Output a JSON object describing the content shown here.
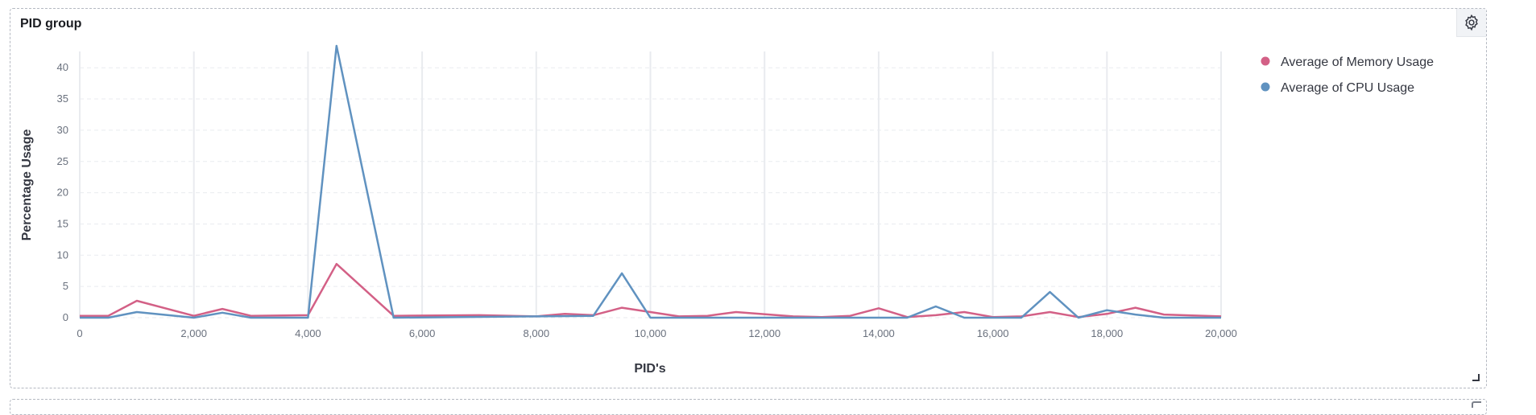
{
  "panel": {
    "title": "PID group"
  },
  "colors": {
    "memory": "#d36086",
    "cpu": "#6092c0",
    "grid": "#e9ebef"
  },
  "chart_data": {
    "type": "line",
    "xlabel": "PID's",
    "ylabel": "Percentage Usage",
    "xlim": [
      0,
      20000
    ],
    "ylim": [
      0,
      45
    ],
    "x_ticks": [
      0,
      2000,
      4000,
      6000,
      8000,
      10000,
      12000,
      14000,
      16000,
      18000,
      20000
    ],
    "x_tick_labels": [
      "0",
      "2,000",
      "4,000",
      "6,000",
      "8,000",
      "10,000",
      "12,000",
      "14,000",
      "16,000",
      "18,000",
      "20,000"
    ],
    "y_ticks": [
      0,
      5,
      10,
      15,
      20,
      25,
      30,
      35,
      40
    ],
    "y_tick_labels": [
      "0",
      "5",
      "10",
      "15",
      "20",
      "25",
      "30",
      "35",
      "40"
    ],
    "grid": true,
    "legend_position": "right",
    "series": [
      {
        "name": "Average of Memory Usage",
        "color": "#d36086",
        "points": [
          [
            0,
            0.3
          ],
          [
            500,
            0.3
          ],
          [
            1000,
            2.7
          ],
          [
            2000,
            0.3
          ],
          [
            2500,
            1.4
          ],
          [
            3000,
            0.3
          ],
          [
            4000,
            0.4
          ],
          [
            4500,
            8.6
          ],
          [
            5500,
            0.3
          ],
          [
            7000,
            0.4
          ],
          [
            8000,
            0.2
          ],
          [
            8500,
            0.6
          ],
          [
            9000,
            0.4
          ],
          [
            9500,
            1.6
          ],
          [
            10500,
            0.2
          ],
          [
            11000,
            0.3
          ],
          [
            11500,
            0.9
          ],
          [
            12500,
            0.2
          ],
          [
            13000,
            0.1
          ],
          [
            13500,
            0.3
          ],
          [
            14000,
            1.5
          ],
          [
            14500,
            0.1
          ],
          [
            15000,
            0.4
          ],
          [
            15500,
            0.9
          ],
          [
            16000,
            0.1
          ],
          [
            16500,
            0.2
          ],
          [
            17000,
            0.9
          ],
          [
            17500,
            0.1
          ],
          [
            18000,
            0.6
          ],
          [
            18500,
            1.6
          ],
          [
            19000,
            0.5
          ],
          [
            20000,
            0.2
          ]
        ]
      },
      {
        "name": "Average of CPU Usage",
        "color": "#6092c0",
        "points": [
          [
            0,
            0
          ],
          [
            500,
            0
          ],
          [
            1000,
            0.9
          ],
          [
            2000,
            0
          ],
          [
            2500,
            0.8
          ],
          [
            3000,
            0
          ],
          [
            4000,
            0
          ],
          [
            4500,
            43.5
          ],
          [
            5500,
            0
          ],
          [
            9000,
            0.3
          ],
          [
            9500,
            7.1
          ],
          [
            10000,
            0
          ],
          [
            14500,
            0
          ],
          [
            15000,
            1.8
          ],
          [
            15500,
            0
          ],
          [
            16500,
            0
          ],
          [
            17000,
            4.1
          ],
          [
            17500,
            0
          ],
          [
            18000,
            1.2
          ],
          [
            18500,
            0.5
          ],
          [
            19000,
            0
          ],
          [
            20000,
            0
          ]
        ]
      }
    ]
  }
}
